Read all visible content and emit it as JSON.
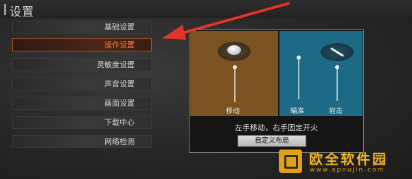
{
  "header": {
    "title": "设置"
  },
  "menu": {
    "items": [
      {
        "label": "基础设置",
        "active": false
      },
      {
        "label": "操作设置",
        "active": true
      },
      {
        "label": "灵敏度设置",
        "active": false
      },
      {
        "label": "声音设置",
        "active": false
      },
      {
        "label": "画面设置",
        "active": false
      },
      {
        "label": "下载中心",
        "active": false
      },
      {
        "label": "网络检测",
        "active": false
      }
    ]
  },
  "control_panel": {
    "left_label": "移动",
    "right_labels": [
      "瞄准",
      "射击"
    ],
    "description": "左手移动，右手固定开火",
    "custom_button": "自定义布局"
  },
  "watermark": {
    "name": "欧全软件园",
    "url": "www.apoujin.com"
  },
  "colors": {
    "accent": "#f07a3c",
    "left_pane": "#7a5321",
    "right_pane": "#1c6a86",
    "arrow": "#e2352a",
    "watermark": "#f0b52a"
  },
  "icons": [
    "joystick-dial-icon",
    "aim-sight-icon",
    "pointer-arrow-icon",
    "site-logo-icon"
  ]
}
